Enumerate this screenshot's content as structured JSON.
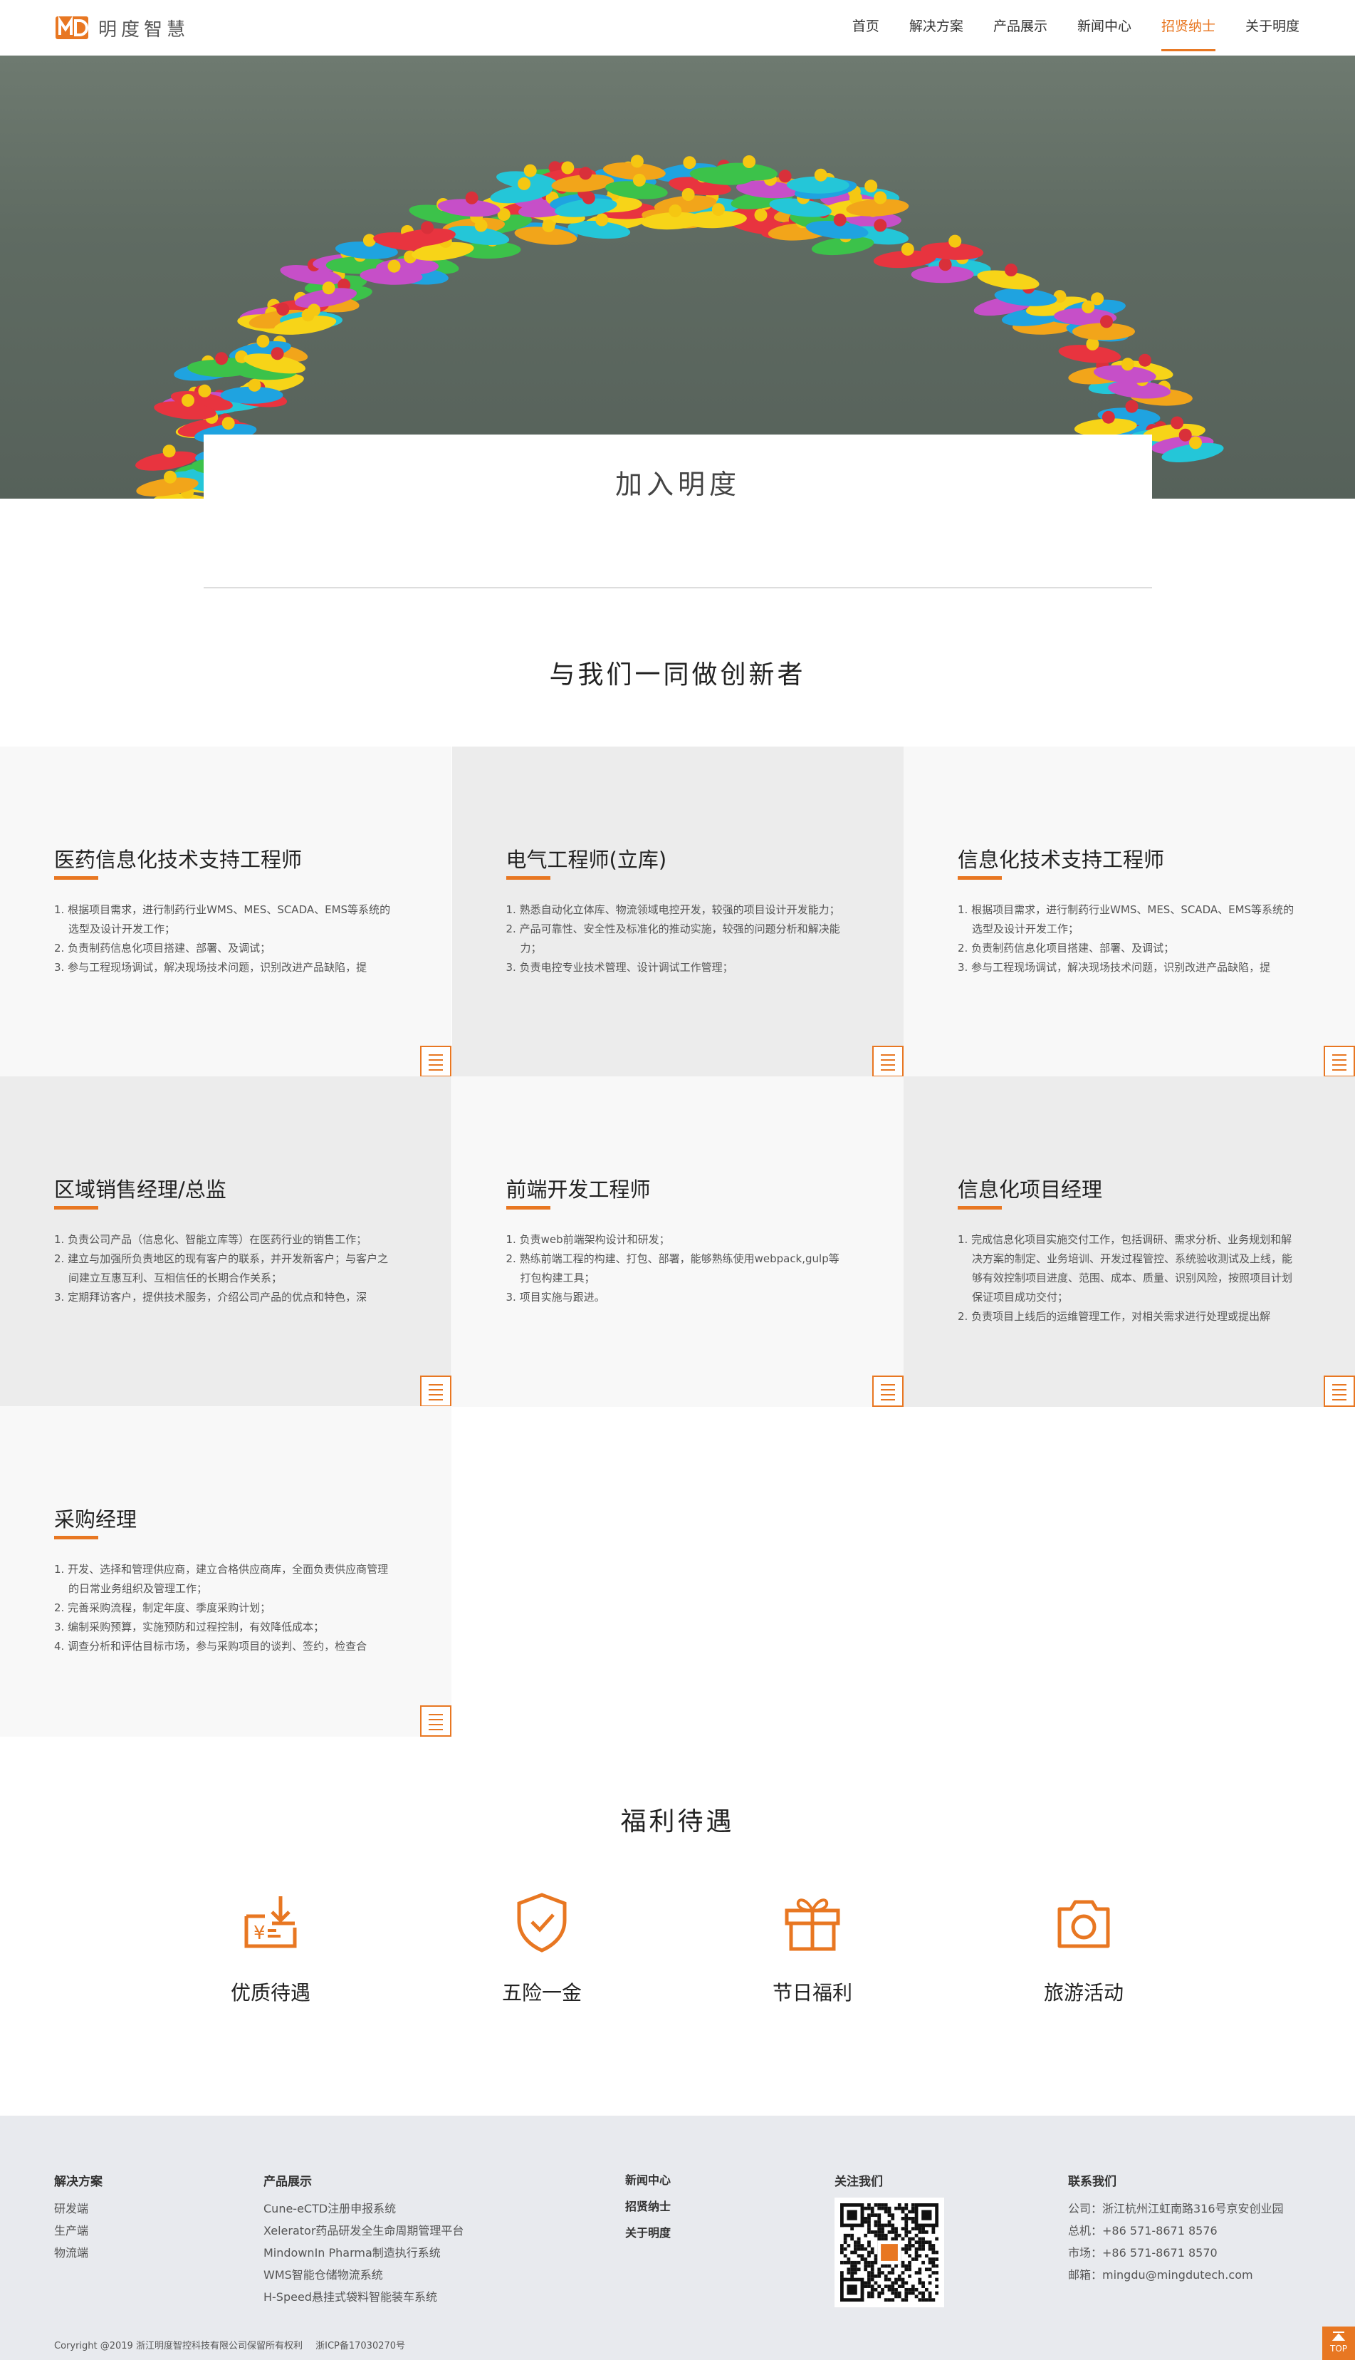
{
  "header": {
    "logo_text": "明度智慧",
    "nav": [
      "首页",
      "解决方案",
      "产品展示",
      "新闻中心",
      "招贤纳士",
      "关于明度"
    ],
    "active_index": 4
  },
  "banner": {
    "title": "加入明度"
  },
  "section_jobs_title": "与我们一同做创新者",
  "jobs": [
    {
      "title": "医药信息化技术支持工程师",
      "items": [
        "1. 根据项目需求，进行制药行业WMS、MES、SCADA、EMS等系统的选型及设计开发工作；",
        "2. 负责制药信息化项目搭建、部署、及调试；",
        "3. 参与工程现场调试，解决现场技术问题，识别改进产品缺陷，提"
      ]
    },
    {
      "title": "电气工程师(立库)",
      "items": [
        "1. 熟悉自动化立体库、物流领域电控开发，较强的项目设计开发能力；",
        "2. 产品可靠性、安全性及标准化的推动实施，较强的问题分析和解决能力；",
        "3. 负责电控专业技术管理、设计调试工作管理；"
      ]
    },
    {
      "title": "信息化技术支持工程师",
      "items": [
        "1. 根据项目需求，进行制药行业WMS、MES、SCADA、EMS等系统的选型及设计开发工作；",
        "2. 负责制药信息化项目搭建、部署、及调试；",
        "3. 参与工程现场调试，解决现场技术问题，识别改进产品缺陷，提"
      ]
    },
    {
      "title": "区域销售经理/总监",
      "items": [
        "1. 负责公司产品（信息化、智能立库等）在医药行业的销售工作；",
        "2. 建立与加强所负责地区的现有客户的联系，并开发新客户；与客户之间建立互惠互利、互相信任的长期合作关系；",
        "3. 定期拜访客户，提供技术服务，介绍公司产品的优点和特色，深"
      ]
    },
    {
      "title": "前端开发工程师",
      "items": [
        "1. 负责web前端架构设计和研发；",
        "2. 熟练前端工程的构建、打包、部署，能够熟练使用webpack,gulp等打包构建工具；",
        "3. 项目实施与跟进。"
      ]
    },
    {
      "title": "信息化项目经理",
      "items": [
        "1. 完成信息化项目实施交付工作，包括调研、需求分析、业务规划和解决方案的制定、业务培训、开发过程管控、系统验收测试及上线，能够有效控制项目进度、范围、成本、质量、识别风险，按照项目计划保证项目成功交付；",
        "2. 负责项目上线后的运维管理工作，对相关需求进行处理或提出解"
      ]
    },
    {
      "title": "采购经理",
      "items": [
        "1. 开发、选择和管理供应商，建立合格供应商库，全面负责供应商管理的日常业务组织及管理工作；",
        "2. 完善采购流程，制定年度、季度采购计划；",
        "3. 编制采购预算，实施预防和过程控制，有效降低成本；",
        "4. 调查分析和评估目标市场，参与采购项目的谈判、签约，检查合"
      ]
    }
  ],
  "section_benefits_title": "福利待遇",
  "benefits": [
    {
      "label": "优质待遇",
      "icon": "salary-icon"
    },
    {
      "label": "五险一金",
      "icon": "shield-check-icon"
    },
    {
      "label": "节日福利",
      "icon": "gift-icon"
    },
    {
      "label": "旅游活动",
      "icon": "camera-icon"
    }
  ],
  "footer": {
    "solutions": {
      "title": "解决方案",
      "items": [
        "研发端",
        "生产端",
        "物流端"
      ]
    },
    "products": {
      "title": "产品展示",
      "items": [
        "Cune-eCTD注册申报系统",
        "Xelerator药品研发全生命周期管理平台",
        "MindownIn Pharma制造执行系统",
        "WMS智能仓储物流系统",
        "H-Speed悬挂式袋料智能装车系统"
      ]
    },
    "links": [
      "新闻中心",
      "招贤纳士",
      "关于明度"
    ],
    "follow_title": "关注我们",
    "contact": {
      "title": "联系我们",
      "items": [
        "公司：浙江杭州江虹南路316号京安创业园",
        "总机：+86 571-8671 8576",
        "市场：+86 571-8671 8570",
        "邮箱：mingdu@mingdutech.com"
      ]
    },
    "copyright": "Coryright @2019 浙江明度智控科技有限公司保留所有权利",
    "icp": "浙ICP备17030270号",
    "top_label": "TOP"
  },
  "colors": {
    "accent": "#e87722",
    "footer_bg": "#e8eaee"
  }
}
